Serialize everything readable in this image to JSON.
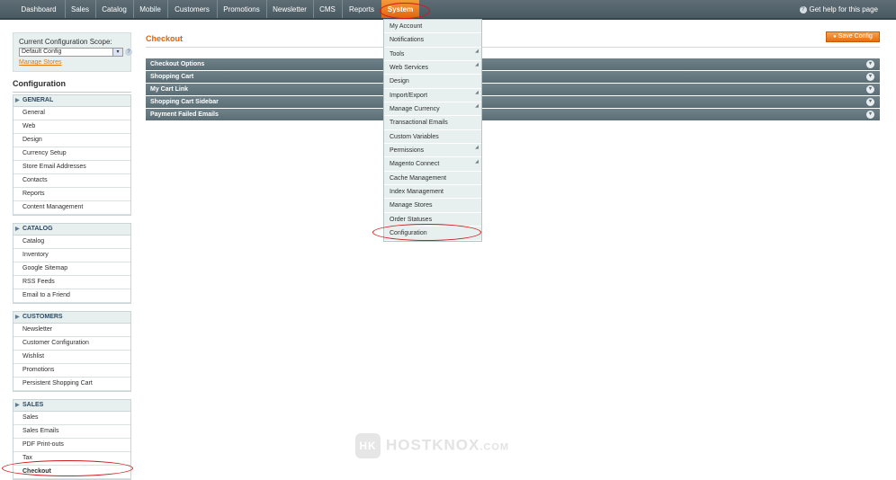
{
  "nav": {
    "items": [
      "Dashboard",
      "Sales",
      "Catalog",
      "Mobile",
      "Customers",
      "Promotions",
      "Newsletter",
      "CMS",
      "Reports",
      "System"
    ],
    "active": "System",
    "help": "Get help for this page"
  },
  "scope": {
    "label": "Current Configuration Scope:",
    "value": "Default Config",
    "manage_stores": "Manage Stores"
  },
  "sidebar": {
    "title": "Configuration",
    "sections": [
      {
        "title": "GENERAL",
        "items": [
          "General",
          "Web",
          "Design",
          "Currency Setup",
          "Store Email Addresses",
          "Contacts",
          "Reports",
          "Content Management"
        ]
      },
      {
        "title": "CATALOG",
        "items": [
          "Catalog",
          "Inventory",
          "Google Sitemap",
          "RSS Feeds",
          "Email to a Friend"
        ]
      },
      {
        "title": "CUSTOMERS",
        "items": [
          "Newsletter",
          "Customer Configuration",
          "Wishlist",
          "Promotions",
          "Persistent Shopping Cart"
        ]
      },
      {
        "title": "SALES",
        "items": [
          "Sales",
          "Sales Emails",
          "PDF Print-outs",
          "Tax",
          "Checkout"
        ]
      }
    ],
    "selected": "Checkout"
  },
  "main": {
    "title": "Checkout",
    "save_label": "Save Config",
    "fieldsets": [
      "Checkout Options",
      "Shopping Cart",
      "My Cart Link",
      "Shopping Cart Sidebar",
      "Payment Failed Emails"
    ]
  },
  "system_menu": {
    "items": [
      {
        "label": "My Account",
        "sub": false
      },
      {
        "label": "Notifications",
        "sub": false
      },
      {
        "label": "Tools",
        "sub": true
      },
      {
        "label": "Web Services",
        "sub": true
      },
      {
        "label": "Design",
        "sub": false
      },
      {
        "label": "Import/Export",
        "sub": true
      },
      {
        "label": "Manage Currency",
        "sub": true
      },
      {
        "label": "Transactional Emails",
        "sub": false
      },
      {
        "label": "Custom Variables",
        "sub": false
      },
      {
        "label": "Permissions",
        "sub": true
      },
      {
        "label": "Magento Connect",
        "sub": true
      },
      {
        "label": "Cache Management",
        "sub": false
      },
      {
        "label": "Index Management",
        "sub": false
      },
      {
        "label": "Manage Stores",
        "sub": false
      },
      {
        "label": "Order Statuses",
        "sub": false
      },
      {
        "label": "Configuration",
        "sub": false
      }
    ]
  },
  "watermark": {
    "text": "HOSTKNOX",
    "suffix": ".COM"
  }
}
